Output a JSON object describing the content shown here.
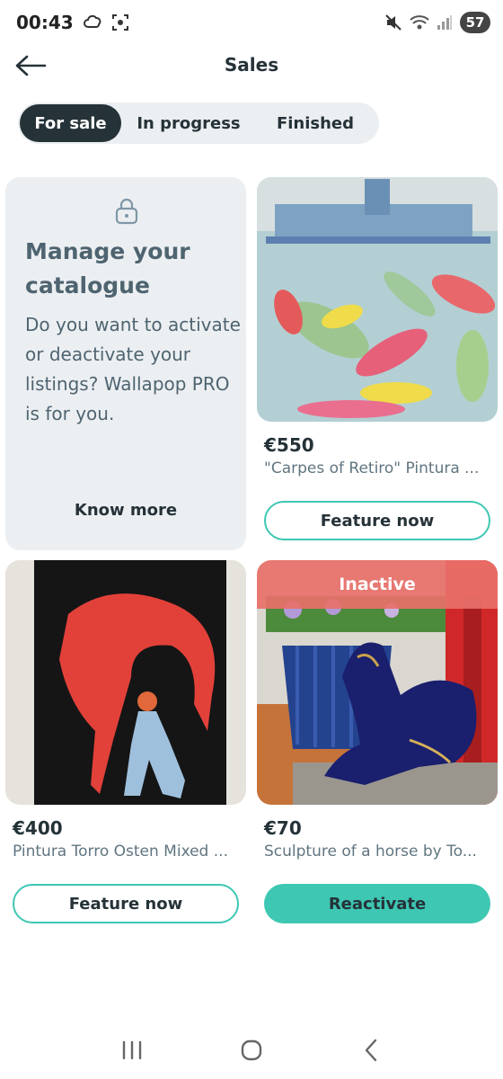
{
  "status_bar": {
    "time": "00:43",
    "battery": "57"
  },
  "header": {
    "title": "Sales"
  },
  "tabs": [
    {
      "label": "For sale",
      "active": true
    },
    {
      "label": "In progress",
      "active": false
    },
    {
      "label": "Finished",
      "active": false
    }
  ],
  "promo": {
    "title": "Manage your catalogue",
    "description": "Do you want to activate or deactivate your listings? Wallapop PRO is for you.",
    "link_label": "Know more"
  },
  "products": [
    {
      "price": "€550",
      "title": "\"Carpes of Retiro\" Pintura ...",
      "button_label": "Feature now",
      "status": ""
    },
    {
      "price": "€400",
      "title": "Pintura Torro Osten Mixed ...",
      "button_label": "Feature now",
      "status": ""
    },
    {
      "price": "€70",
      "title": "Sculpture of a horse by To...",
      "button_label": "Reactivate",
      "status": "Inactive"
    }
  ],
  "colors": {
    "accent": "#3ec7b3",
    "dark": "#253238",
    "inactive_banner": "#e8706a"
  }
}
